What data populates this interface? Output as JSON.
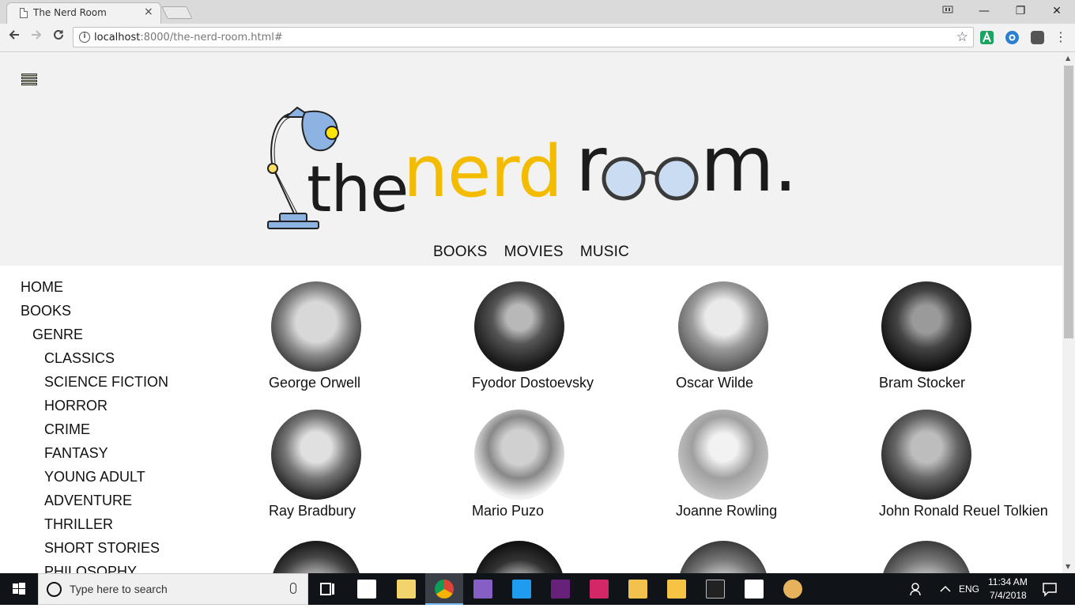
{
  "browser": {
    "tab_title": "The Nerd Room",
    "tab_close": "×",
    "url_host": "localhost",
    "url_rest": ":8000/the-nerd-room.html#",
    "window_min": "—",
    "window_restore": "❐",
    "window_close": "✕"
  },
  "site": {
    "logo": {
      "the": "the",
      "nerd": "nerd",
      "r": "r",
      "m": "m.",
      "accent_color": "#f4bc00",
      "lamp_color": "#8db3e2"
    },
    "top_nav": [
      "BOOKS",
      "MOVIES",
      "MUSIC"
    ],
    "sidebar": {
      "home": "HOME",
      "books": "BOOKS",
      "genre": "GENRE",
      "genres": [
        "CLASSICS",
        "SCIENCE FICTION",
        "HORROR",
        "CRIME",
        "FANTASY",
        "YOUNG ADULT",
        "ADVENTURE",
        "THRILLER",
        "SHORT STORIES",
        "PHILOSOPHY"
      ]
    },
    "authors": [
      "George Orwell",
      "Fyodor Dostoevsky",
      "Oscar Wilde",
      "Bram Stocker",
      "Ray Bradbury",
      "Mario Puzo",
      "Joanne Rowling",
      "John Ronald Reuel Tolkien"
    ]
  },
  "taskbar": {
    "search_placeholder": "Type here to search",
    "language": "ENG",
    "time": "11:34 AM",
    "date": "7/4/2018"
  }
}
